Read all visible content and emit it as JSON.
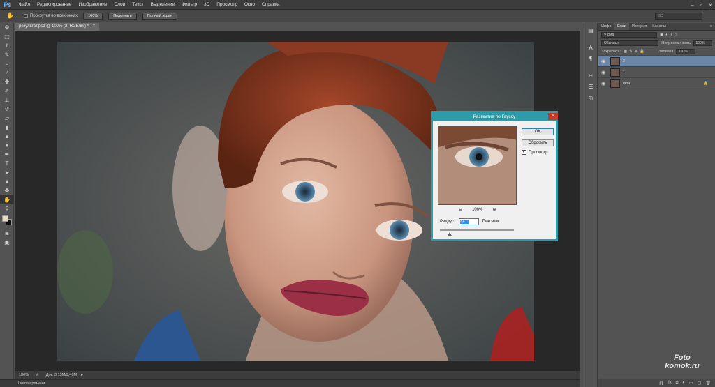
{
  "app": {
    "logo": "Ps"
  },
  "menu": [
    "Файл",
    "Редактирование",
    "Изображение",
    "Слои",
    "Текст",
    "Выделение",
    "Фильтр",
    "3D",
    "Просмотр",
    "Окно",
    "Справка"
  ],
  "window_controls": [
    "minimize-icon",
    "maximize-icon",
    "close-icon"
  ],
  "options": {
    "tool_icon": "hand-icon",
    "scroll_all_label": "Прокрутка во всех окнах",
    "btn_100": "100%",
    "btn_fit": "Подогнать",
    "btn_fullscreen": "Полный экран",
    "workspace": "3D"
  },
  "document": {
    "tab_title": "результат.psd @ 100% (2, RGB/8#) *",
    "zoom": "100%",
    "doc_size": "Док: 3,13M/9,40M",
    "timeline_label": "Шкала времени"
  },
  "panel": {
    "tabs": [
      "Инфо",
      "Слои",
      "История",
      "Каналы"
    ],
    "active_tab": "Слои",
    "filter_label": "Вид",
    "blend_mode": "Обычные",
    "opacity_label": "Непрозрачность:",
    "opacity_value": "100%",
    "lock_label": "Закрепить:",
    "fill_label": "Заливка:",
    "fill_value": "100%",
    "layers": [
      {
        "name": "2",
        "selected": true
      },
      {
        "name": "1",
        "selected": false
      },
      {
        "name": "Фон",
        "selected": false
      }
    ]
  },
  "dialog": {
    "title": "Размытие по Гауссу",
    "ok": "OK",
    "reset": "Сбросить",
    "preview_label": "Просмотр",
    "preview_checked": true,
    "zoom": "100%",
    "radius_label": "Радиус:",
    "radius_value": "2,4",
    "radius_unit": "Пиксели",
    "radius_fraction": 0.12
  },
  "watermark": {
    "line1": "Foto",
    "line2": "komok.ru"
  },
  "colors": {
    "dialog_border": "#2e9ba8",
    "selected_layer": "#6c86a8",
    "ps_blue": "#5fb2ff"
  }
}
